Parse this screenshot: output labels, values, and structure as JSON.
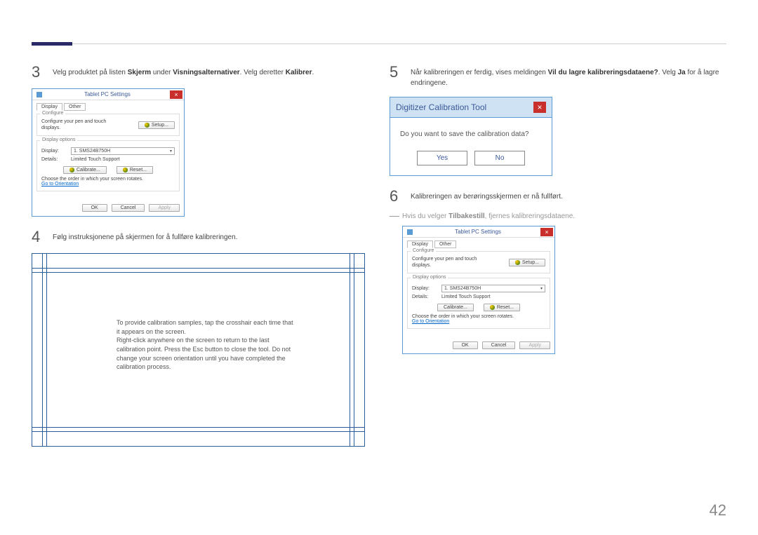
{
  "page_number": "42",
  "steps": {
    "s3": {
      "num": "3",
      "pre": "Velg produktet på listen ",
      "b1": "Skjerm",
      "mid1": " under ",
      "b2": "Visningsalternativer",
      "mid2": ". Velg deretter ",
      "b3": "Kalibrer",
      "post": "."
    },
    "s4": {
      "num": "4",
      "text": "Følg instruksjonene på skjermen for å fullføre kalibreringen."
    },
    "s5": {
      "num": "5",
      "pre": "Når kalibreringen er ferdig, vises meldingen ",
      "b1": "Vil du lagre kalibreringsdataene?",
      "mid1": ". Velg ",
      "b2": "Ja",
      "post": " for å lagre endringene."
    },
    "s6": {
      "num": "6",
      "text": "Kalibreringen av berøringsskjermen er nå fullført."
    }
  },
  "note": {
    "pre": "Hvis du velger ",
    "b": "Tilbakestill",
    "post": ", fjernes kalibreringsdataene."
  },
  "tps": {
    "title": "Tablet PC Settings",
    "tab_display": "Display",
    "tab_other": "Other",
    "group_configure": "Configure",
    "configure_text": "Configure your pen and touch displays.",
    "setup_btn": "Setup...",
    "group_display": "Display options",
    "display_label": "Display:",
    "display_value": "1. SMS24B750H",
    "details_label": "Details:",
    "details_value": "Limited Touch Support",
    "calibrate_btn": "Calibrate...",
    "reset_btn": "Reset...",
    "rotate_note": "Choose the order in which your screen rotates.",
    "orientation_link": "Go to Orientation",
    "ok_btn": "OK",
    "cancel_btn": "Cancel",
    "apply_btn": "Apply"
  },
  "calib_text": "To provide calibration samples, tap the crosshair each time that it appears on the screen.\nRight-click anywhere on the screen to return to the last calibration point. Press the Esc button to close the tool. Do not change your screen orientation until you have completed the calibration process.",
  "digi": {
    "title": "Digitizer Calibration Tool",
    "question": "Do you want to save the calibration data?",
    "yes": "Yes",
    "no": "No"
  }
}
